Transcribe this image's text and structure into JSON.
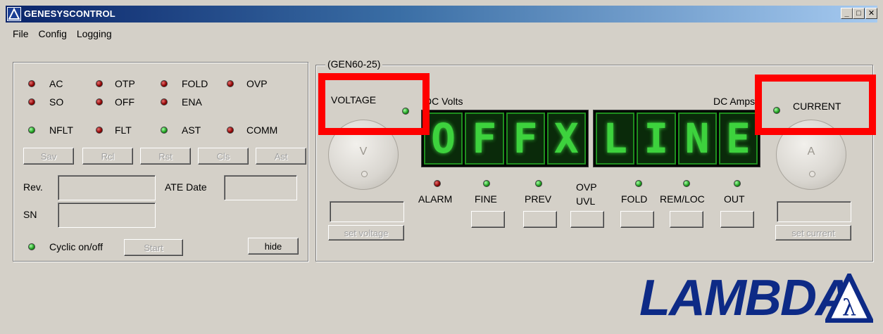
{
  "window": {
    "title": "GENESYSCONTROL",
    "controls": [
      "_",
      "□",
      "✕"
    ]
  },
  "menu": [
    "File",
    "Config",
    "Logging"
  ],
  "status_panel": {
    "leds": [
      {
        "label": "AC",
        "color": "red"
      },
      {
        "label": "OTP",
        "color": "red"
      },
      {
        "label": "FOLD",
        "color": "red"
      },
      {
        "label": "OVP",
        "color": "red"
      },
      {
        "label": "SO",
        "color": "red"
      },
      {
        "label": "OFF",
        "color": "red"
      },
      {
        "label": "ENA",
        "color": "red"
      },
      {
        "label": "NFLT",
        "color": "green"
      },
      {
        "label": "FLT",
        "color": "red"
      },
      {
        "label": "AST",
        "color": "green"
      },
      {
        "label": "COMM",
        "color": "red"
      }
    ],
    "buttons": [
      "Sav",
      "Rcl",
      "Rst",
      "Cls",
      "Ast"
    ],
    "rev_label": "Rev.",
    "rev_value": "",
    "ate_date_label": "ATE Date",
    "ate_date_value": "",
    "sn_label": "SN",
    "sn_value": "",
    "cyclic_label": "Cyclic on/off",
    "start_label": "Start",
    "hide_label": "hide"
  },
  "device": {
    "group_label": "(GEN60-25)",
    "voltage_label": "VOLTAGE",
    "dc_volts_label": "DC Volts",
    "dc_amps_label": "DC Amps",
    "current_label": "CURRENT",
    "voltage_knob_label": "V",
    "current_knob_label": "A",
    "display_text": [
      "O",
      "F",
      "F",
      "X",
      "L",
      "I",
      "N",
      "E"
    ],
    "set_voltage_label": "set voltage",
    "set_current_label": "set current",
    "indicators": [
      {
        "label": "ALARM",
        "led": "red"
      },
      {
        "label": "FINE",
        "led": "green"
      },
      {
        "label": "PREV",
        "led": "green"
      },
      {
        "label": "OVP\nUVL",
        "led": "none"
      },
      {
        "label": "FOLD",
        "led": "green"
      },
      {
        "label": "REM/LOC",
        "led": "green"
      },
      {
        "label": "OUT",
        "led": "green"
      }
    ]
  },
  "logo": {
    "text": "LAMBDA",
    "symbol": "λ"
  },
  "colors": {
    "highlight": "#ff0000",
    "display_segment": "#3dd23d",
    "brand": "#0d2a86"
  }
}
